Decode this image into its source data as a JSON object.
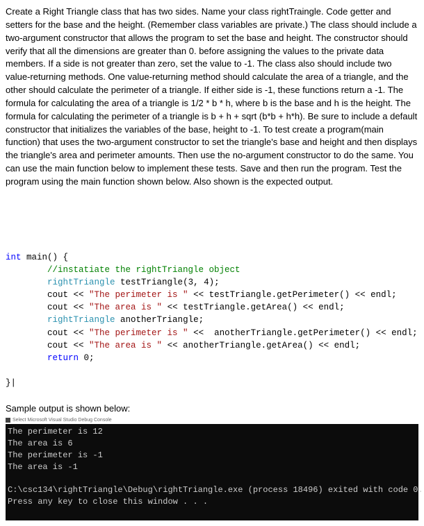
{
  "problem": {
    "text": "Create a Right Triangle class that has two sides. Name your class rightTraingle. Code getter and setters for the base and the height. (Remember  class variables are private.)  The class should include a two-argument constructor that allows the program to set the base and height.  The constructor should verify that all the dimensions are greater than 0. before assigning the values to the private data members.  If a side is not greater than zero, set the value to -1.  The class also should include two value-returning methods. One value-returning method  should calculate the area of a triangle, and the other should calculate the perimeter of a triangle. If either side is -1, these functions return a -1. The formula for calculating the area of a triangle is 1/2 * b * h, where b is the base and h is the height. The formula for calculating the perimeter of a triangle is b + h + sqrt (b*b + h*h). Be sure to include a default constructor that initializes the variables of the base, height to -1. To test create a program(main function) that uses the two-argument constructor to set the triangle's base and height and then displays the triangle's area and perimeter amounts. Then use the no-argument constructor to do the same.  You can use the main function below to implement these tests. Save and then run the program. Test the program using the main function shown below.  Also shown is the expected  output."
  },
  "code": {
    "kw_int": "int",
    "fn_main": "main",
    "comment": "//instatiate the rightTriangle object",
    "type_rt": "rightTriangle",
    "var_test": "testTriangle",
    "args": "(3, 4);",
    "cout": "cout",
    "lt": "<<",
    "str_perim": "\"The perimeter is \"",
    "str_area": "\"The area is \"",
    "call_getPer": "testTriangle.getPerimeter()",
    "call_getArea": "testTriangle.getArea()",
    "endl": "endl",
    "var_another": "anotherTriangle",
    "call_getPer2": "anotherTriangle.getPerimeter()",
    "call_getArea2": "anotherTriangle.getArea()",
    "kw_return": "return",
    "zero": "0",
    "close": "}|"
  },
  "sample": {
    "label": "Sample output is shown below:",
    "console_title": "Select Microsoft Visual Studio Debug Console",
    "line1": "The perimeter is 12",
    "line2": "The area is 6",
    "line3": "The perimeter is -1",
    "line4": "The area is -1",
    "exit": "C:\\csc134\\rightTriangle\\Debug\\rightTriangle.exe (process 18496) exited with code 0.",
    "press": "Press any key to close this window . . ."
  }
}
